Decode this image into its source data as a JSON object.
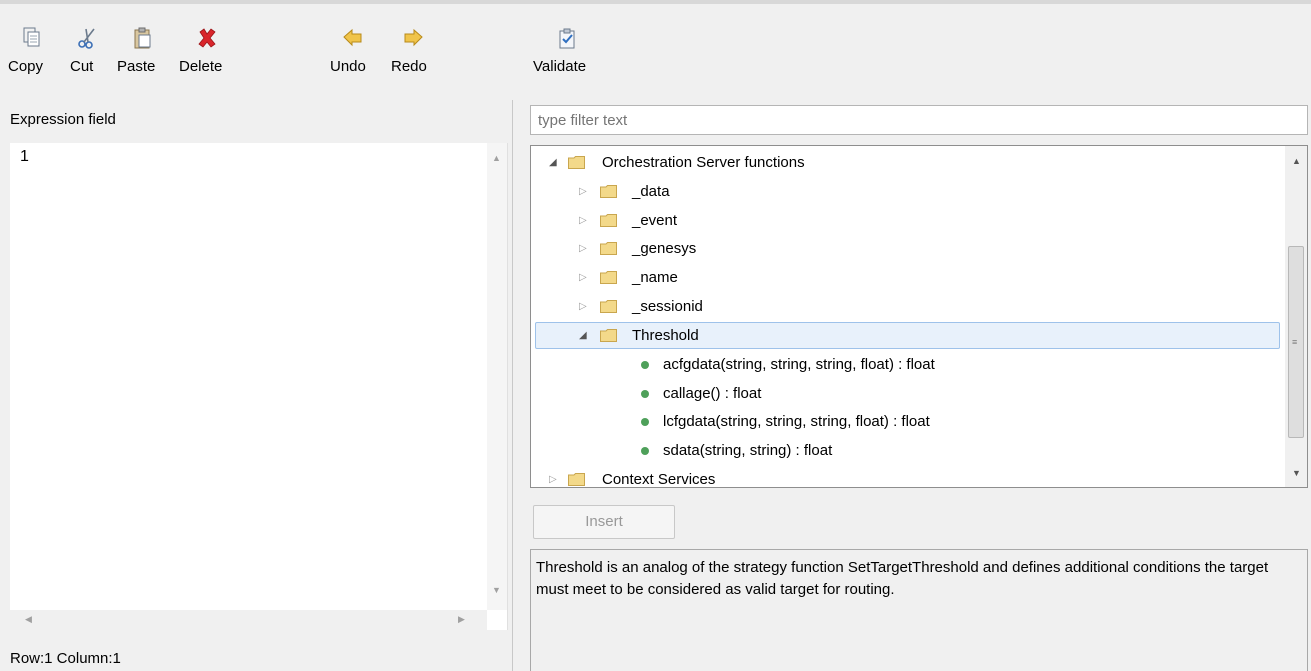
{
  "toolbar": {
    "copy": "Copy",
    "cut": "Cut",
    "paste": "Paste",
    "delete": "Delete",
    "undo": "Undo",
    "redo": "Redo",
    "validate": "Validate"
  },
  "editor": {
    "label": "Expression field",
    "line_number": "1",
    "status": "Row:1 Column:1"
  },
  "filter": {
    "placeholder": "type filter text"
  },
  "tree": {
    "root": "Orchestration Server functions",
    "folders": [
      "_data",
      "_event",
      "_genesys",
      "_name",
      "_sessionid"
    ],
    "selected_folder": "Threshold",
    "functions": [
      "acfgdata(string, string, string, float) : float",
      "callage() : float",
      "lcfgdata(string, string, string, float) : float",
      "sdata(string, string) : float"
    ],
    "next_root": "Context Services"
  },
  "insert_button": "Insert",
  "description": "Threshold is an analog of the strategy function SetTargetThreshold and defines additional conditions the target must meet to be considered as valid target for routing.",
  "colors": {
    "folder": "#f3d98a",
    "function_dot": "#4ea05a",
    "selection": "#e8f1fb",
    "arrow_yellow": "#e8b42c",
    "delete_red": "#d9252b"
  }
}
